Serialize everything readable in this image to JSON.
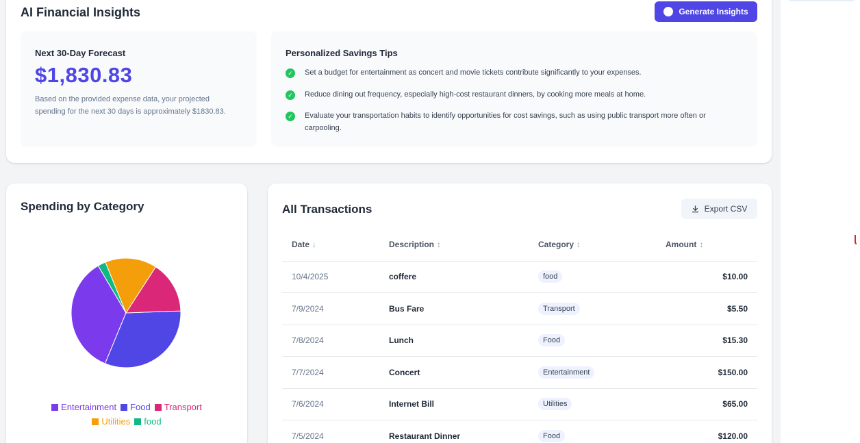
{
  "insights": {
    "title": "AI Financial Insights",
    "generate_label": "Generate Insights",
    "forecast": {
      "label": "Next 30-Day Forecast",
      "amount": "$1,830.83",
      "description": "Based on the provided expense data, your projected spending for the next 30 days is approximately $1830.83."
    },
    "tips": {
      "title": "Personalized Savings Tips",
      "items": [
        "Set a budget for entertainment as concert and movie tickets contribute significantly to your expenses.",
        "Reduce dining out frequency, especially high-cost restaurant dinners, by cooking more meals at home.",
        "Evaluate your transportation habits to identify opportunities for cost savings, such as using public transport more often or carpooling."
      ]
    }
  },
  "spending": {
    "title": "Spending by Category"
  },
  "chart_data": {
    "type": "pie",
    "categories": [
      "Entertainment",
      "Food",
      "Transport",
      "Utilities",
      "food"
    ],
    "values": [
      150,
      135.3,
      65,
      65,
      10
    ],
    "colors": [
      "#7c3aed",
      "#4f46e5",
      "#db2777",
      "#f59e0b",
      "#10b981"
    ],
    "legend_position": "bottom"
  },
  "transactions": {
    "title": "All Transactions",
    "export_label": "Export CSV",
    "columns": [
      {
        "label": "Date",
        "sort": "↓"
      },
      {
        "label": "Description",
        "sort": "↕"
      },
      {
        "label": "Category",
        "sort": "↕"
      },
      {
        "label": "Amount",
        "sort": "↕"
      }
    ],
    "rows": [
      {
        "date": "10/4/2025",
        "description": "coffere",
        "category": "food",
        "amount": "$10.00"
      },
      {
        "date": "7/9/2024",
        "description": "Bus Fare",
        "category": "Transport",
        "amount": "$5.50"
      },
      {
        "date": "7/8/2024",
        "description": "Lunch",
        "category": "Food",
        "amount": "$15.30"
      },
      {
        "date": "7/7/2024",
        "description": "Concert",
        "category": "Entertainment",
        "amount": "$150.00"
      },
      {
        "date": "7/6/2024",
        "description": "Internet Bill",
        "category": "Utilities",
        "amount": "$65.00"
      },
      {
        "date": "7/5/2024",
        "description": "Restaurant Dinner",
        "category": "Food",
        "amount": "$120.00"
      }
    ]
  }
}
